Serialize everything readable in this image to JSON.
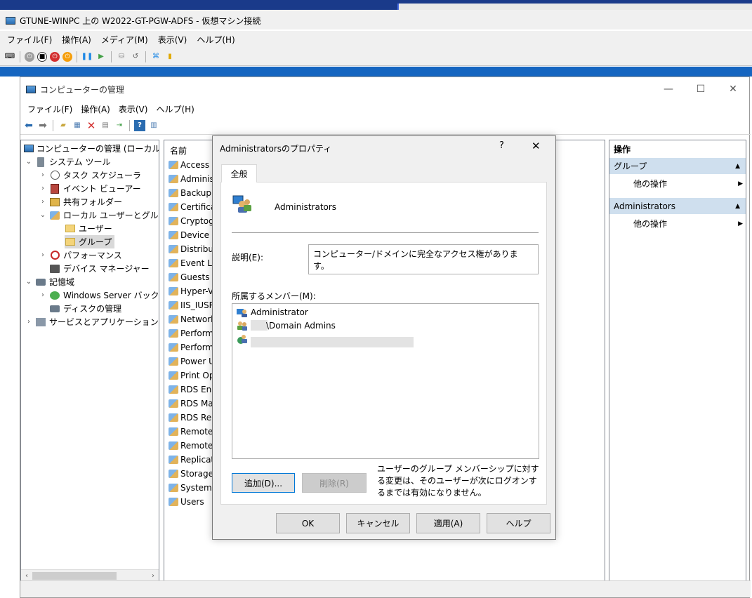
{
  "vm": {
    "title": "GTUNE-WINPC 上の W2022-GT-PGW-ADFS - 仮想マシン接続",
    "menu": [
      "ファイル(F)",
      "操作(A)",
      "メディア(M)",
      "表示(V)",
      "ヘルプ(H)"
    ]
  },
  "cm": {
    "title": "コンピューターの管理",
    "controls": {
      "minimize": "—",
      "maximize": "☐",
      "close": "✕"
    },
    "menu": [
      "ファイル(F)",
      "操作(A)",
      "表示(V)",
      "ヘルプ(H)"
    ],
    "tree": [
      {
        "label": "コンピューターの管理 (ローカル)",
        "exp": "",
        "icon": "computer-icon",
        "level": 0
      },
      {
        "label": "システム ツール",
        "exp": "⌄",
        "icon": "tools-icon",
        "level": 1
      },
      {
        "label": "タスク スケジューラ",
        "exp": "›",
        "icon": "clock-icon",
        "level": 2
      },
      {
        "label": "イベント ビューアー",
        "exp": "›",
        "icon": "event-viewer-icon",
        "level": 2
      },
      {
        "label": "共有フォルダー",
        "exp": "›",
        "icon": "shared-folder-icon",
        "level": 2
      },
      {
        "label": "ローカル ユーザーとグループ",
        "exp": "⌄",
        "icon": "users-groups-icon",
        "level": 2
      },
      {
        "label": "ユーザー",
        "exp": "",
        "icon": "folder-icon",
        "level": 3
      },
      {
        "label": "グループ",
        "exp": "",
        "icon": "folder-icon",
        "level": 3,
        "selected": true
      },
      {
        "label": "パフォーマンス",
        "exp": "›",
        "icon": "performance-icon",
        "level": 2
      },
      {
        "label": "デバイス マネージャー",
        "exp": "",
        "icon": "device-manager-icon",
        "level": 2
      },
      {
        "label": "記憶域",
        "exp": "⌄",
        "icon": "storage-icon",
        "level": 1
      },
      {
        "label": "Windows Server バックアップ",
        "exp": "›",
        "icon": "backup-icon",
        "level": 2
      },
      {
        "label": "ディスクの管理",
        "exp": "",
        "icon": "disk-icon",
        "level": 2
      },
      {
        "label": "サービスとアプリケーション",
        "exp": "›",
        "icon": "services-icon",
        "level": 1
      }
    ],
    "list_header": "名前",
    "groups": [
      "Access C",
      "Administ",
      "Backup O",
      "Certificat",
      "Cryptogr",
      "Device O",
      "Distribut",
      "Event Lo",
      "Guests",
      "Hyper-V",
      "IIS_IUSRS",
      "Network",
      "Performa",
      "Performa",
      "Power Us",
      "Print Op",
      "RDS End",
      "RDS Mar",
      "RDS Rem",
      "Remote",
      "Remote",
      "Replicato",
      "Storage",
      "System M",
      "Users"
    ],
    "actions": {
      "header": "操作",
      "sections": [
        {
          "title": "グループ",
          "item": "他の操作"
        },
        {
          "title": "Administrators",
          "item": "他の操作"
        }
      ]
    }
  },
  "dialog": {
    "title": "Administratorsのプロパティ",
    "help": "?",
    "close": "✕",
    "tab": "全般",
    "group_name": "Administrators",
    "desc_label": "説明(E):",
    "desc_value": "コンピューター/ドメインに完全なアクセス権があります。",
    "members_label": "所属するメンバー(M):",
    "members": [
      {
        "name": "Administrator",
        "icon": "user-icon"
      },
      {
        "name": "\\Domain Admins",
        "icon": "domain-group-icon"
      },
      {
        "name": "",
        "icon": "domain-user-icon"
      }
    ],
    "add_label": "追加(D)...",
    "remove_label": "削除(R)",
    "note": "ユーザーのグループ メンバーシップに対する変更は、そのユーザーが次にログオンするまでは有効になりません。",
    "buttons": [
      "OK",
      "キャンセル",
      "適用(A)",
      "ヘルプ"
    ]
  },
  "colors": {
    "accent": "#0078d7",
    "vm_bar": "#1565c0",
    "action_section": "#cfdfee"
  }
}
